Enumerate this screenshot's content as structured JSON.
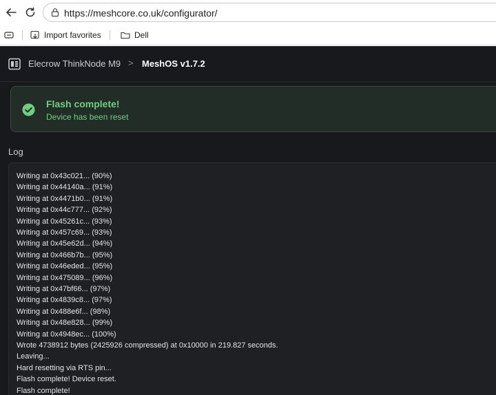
{
  "browser": {
    "url": "https://meshcore.co.uk/configurator/",
    "favorites": [
      {
        "label": "Import favorites"
      },
      {
        "label": "Dell"
      }
    ]
  },
  "header": {
    "device": "Elecrow ThinkNode M9",
    "separator": ">",
    "firmware": "MeshOS v1.7.2"
  },
  "alert": {
    "title": "Flash complete!",
    "subtitle": "Device has been reset",
    "color": "#6fcf7f"
  },
  "log": {
    "heading": "Log",
    "lines": [
      "Writing at 0x43c021... (90%)",
      "Writing at 0x44140a... (91%)",
      "Writing at 0x4471b0... (91%)",
      "Writing at 0x44c777... (92%)",
      "Writing at 0x45261c... (93%)",
      "Writing at 0x457c69... (93%)",
      "Writing at 0x45e62d... (94%)",
      "Writing at 0x466b7b... (95%)",
      "Writing at 0x46eded... (95%)",
      "Writing at 0x475089... (96%)",
      "Writing at 0x47bf66... (97%)",
      "Writing at 0x4839c8... (97%)",
      "Writing at 0x488e6f... (98%)",
      "Writing at 0x48e828... (99%)",
      "Writing at 0x4948ec... (100%)",
      "Wrote 4738912 bytes (2425926 compressed) at 0x10000 in 219.827 seconds.",
      "Leaving...",
      "Hard resetting via RTS pin...",
      "Flash complete! Device reset.",
      "Flash complete!"
    ]
  }
}
